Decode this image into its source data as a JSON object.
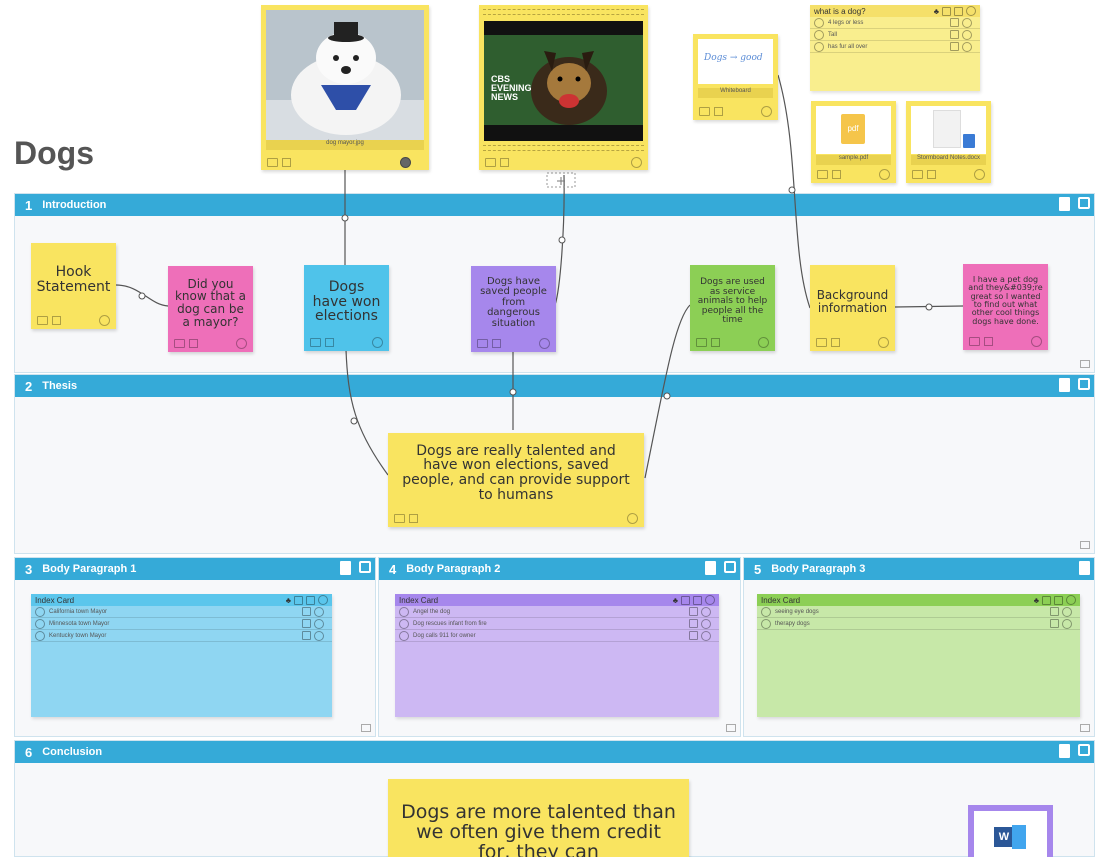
{
  "board": {
    "title": "Dogs"
  },
  "sections": [
    {
      "number": "1",
      "title": "Introduction"
    },
    {
      "number": "2",
      "title": "Thesis"
    },
    {
      "number": "3",
      "title": "Body Paragraph 1"
    },
    {
      "number": "4",
      "title": "Body Paragraph 2"
    },
    {
      "number": "5",
      "title": "Body Paragraph 3"
    },
    {
      "number": "6",
      "title": "Conclusion"
    }
  ],
  "media": {
    "photo_caption": "dog mayor.jpg",
    "video_title": "CBS EVENING NEWS",
    "whiteboard_caption": "Whiteboard",
    "whiteboard_sketch": "Dogs → good",
    "pdf_caption": "sample.pdf",
    "pdf_label": "pdf",
    "docx_caption": "Stormboard Notes.docx",
    "word_icon_letter": "W"
  },
  "top_list": {
    "title": "what is a dog?",
    "items": [
      "4 legs or less",
      "Tall",
      "has fur all over"
    ]
  },
  "notes": {
    "hook": "Hook Statement",
    "did_you_know": "Did you know that a dog can be a mayor?",
    "won_elections": "Dogs have won elections",
    "saved_people": "Dogs have saved people from dangerous situation",
    "service_animals": "Dogs are used as service animals to help people all the time",
    "background": "Background information",
    "pet_dog": "I have a pet dog and they&#039;re great so I wanted to find out what other cool things dogs have done.",
    "thesis": "Dogs are really talented and have won elections, saved people, and can provide support to humans",
    "conclusion": "Dogs are more talented than we often give them credit for, they can"
  },
  "index_cards": [
    {
      "title": "Index Card",
      "items": [
        "California town Mayor",
        "Minnesota town Mayor",
        "Kentucky town Mayor"
      ]
    },
    {
      "title": "Index Card",
      "items": [
        "Angel the dog",
        "Dog rescues infant from fire",
        "Dog calls 911 for owner"
      ]
    },
    {
      "title": "Index Card",
      "items": [
        "seeing eye dogs",
        "therapy dogs"
      ]
    }
  ],
  "colors": {
    "section_header": "#35aad8",
    "yellow": "#f9e460",
    "pink": "#ee6fb9",
    "blue": "#4fc3ea",
    "purple": "#a687ec",
    "green": "#8ccf55"
  }
}
